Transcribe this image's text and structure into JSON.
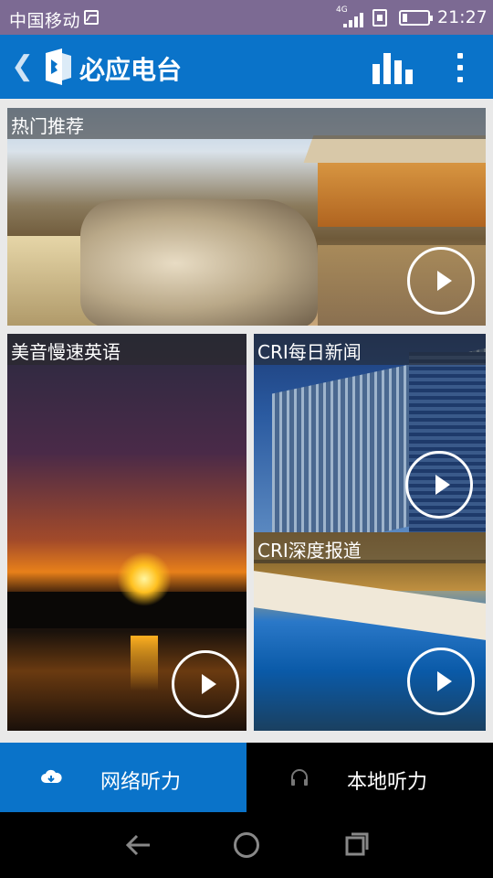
{
  "status_bar": {
    "carrier": "中国移动",
    "network": "4G",
    "battery_level": 0.2,
    "time": "21:27"
  },
  "app_bar": {
    "title": "必应电台",
    "icons": [
      "back-arrow-icon",
      "app-logo-icon",
      "stats-bars-icon",
      "more-vertical-icon"
    ]
  },
  "cards": [
    {
      "label": "热门推荐",
      "icon": "play-icon"
    },
    {
      "label": "美音慢速英语",
      "icon": "play-icon"
    },
    {
      "label": "CRI每日新闻",
      "icon": "play-icon"
    },
    {
      "label": "CRI深度报道",
      "icon": "play-icon"
    }
  ],
  "bottom_nav": {
    "tabs": [
      {
        "label": "网络听力",
        "icon": "cloud-icon",
        "selected": true
      },
      {
        "label": "本地听力",
        "icon": "headphones-icon",
        "selected": false
      }
    ]
  },
  "colors": {
    "accent": "#0a73c9",
    "status_bar": "#7c6a93"
  }
}
